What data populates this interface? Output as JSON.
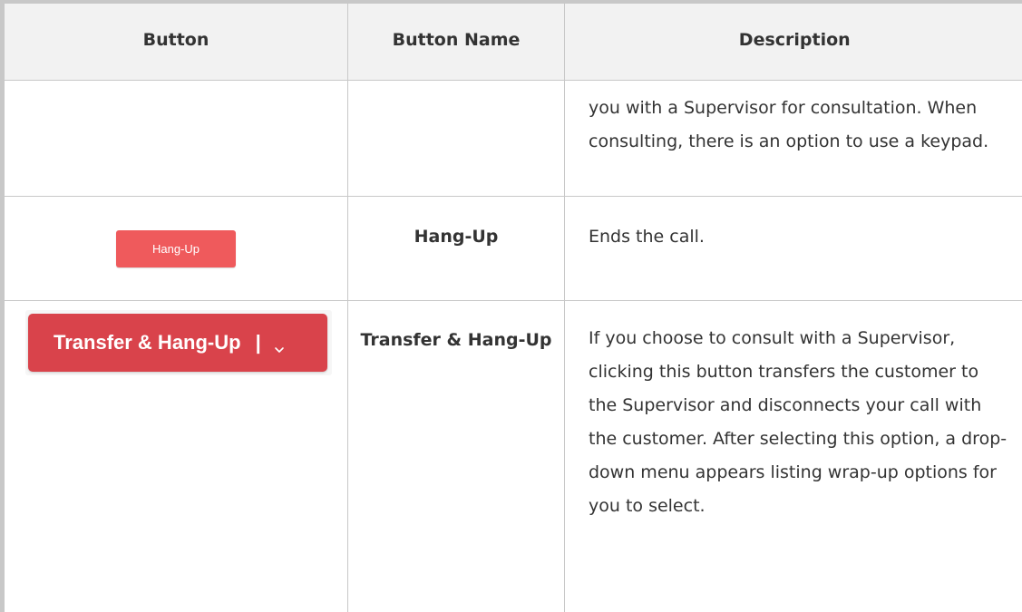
{
  "table": {
    "headers": [
      "Button",
      "Button Name",
      "Description"
    ],
    "rows": [
      {
        "button_label": "",
        "name": "",
        "description": "you with a Supervisor for consultation. When consulting, there is an option to use a keypad."
      },
      {
        "button_label": "Hang-Up",
        "name": "Hang-Up",
        "description": "Ends the call."
      },
      {
        "button_label": "Transfer & Hang-Up",
        "button_separator": "|",
        "name": "Transfer & Hang-Up",
        "description": "If you choose to consult with a Supervisor, clicking this button transfers the customer to the Supervisor and disconnects your call with the customer. After selecting this option, a drop-down menu appears listing wrap-up options for you to select."
      }
    ]
  },
  "colors": {
    "header_bg": "#f2f2f2",
    "border": "#c8c8c8",
    "hangup_button": "#ef5a5c",
    "transfer_button": "#d9434b",
    "text": "#333333"
  },
  "icons": {
    "transfer_dropdown": "chevron-down-icon"
  }
}
